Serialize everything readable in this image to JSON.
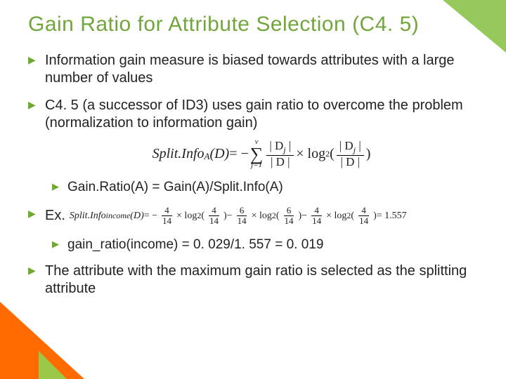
{
  "title": "Gain Ratio for Attribute Selection (C4. 5)",
  "bullets": {
    "b1": "Information gain measure is biased towards attributes with a large number of values",
    "b2": "C4. 5 (a successor of ID3) uses gain ratio to overcome the problem (normalization to information gain)",
    "b2_sub1": "Gain.Ratio(A) = Gain(A)/Split.Info(A)",
    "b3": "Ex.",
    "b3_sub1": "gain_ratio(income) = 0. 029/1. 557 = 0. 019",
    "b4": "The attribute with the maximum gain ratio is selected as the splitting attribute"
  },
  "formula_main": {
    "lhs_name": "Split.Info",
    "lhs_sub": "A",
    "lhs_arg": "(D)",
    "eq": " = − ",
    "sum_lower": "j=1",
    "sum_upper": "v",
    "frac1_num": "| D",
    "frac1_num_sub": "j",
    "frac1_num_end": " |",
    "frac1_den": "| D |",
    "times": " × log",
    "log_sub": "2",
    "lparen": "(",
    "rparen": ")"
  },
  "formula_ex": {
    "lhs": "Split.Info",
    "lhs_sub": "income",
    "lhs_arg": "(D)",
    "eq": "  =  − ",
    "t1_num": "4",
    "t1_den": "14",
    "t1_log": " × log",
    "t1_logsub": "2",
    "t1_arg_num": "4",
    "t1_arg_den": "14",
    "minus": " − ",
    "t2_num": "6",
    "t2_den": "14",
    "t2_arg_num": "6",
    "t2_arg_den": "14",
    "t3_num": "4",
    "t3_den": "14",
    "t3_arg_num": "4",
    "t3_arg_den": "14",
    "result": " = 1.557"
  }
}
